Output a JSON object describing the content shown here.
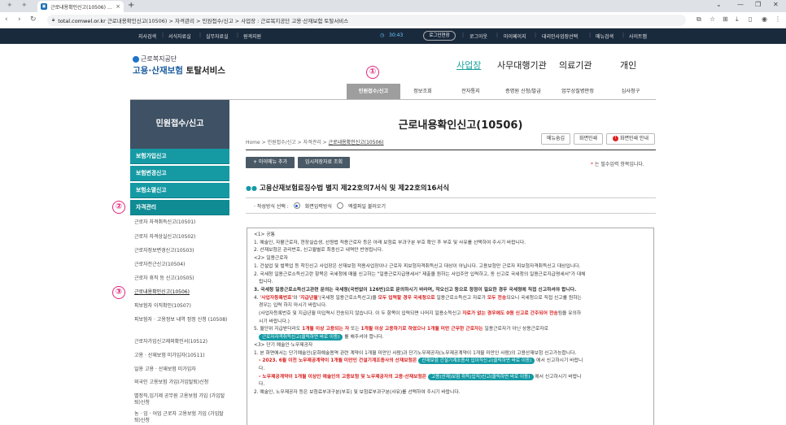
{
  "browser": {
    "tab_title": "근로내용확인신고(10506) : 자",
    "new_tab": "+",
    "url_host": "total.comwel.or.kr",
    "url_rest": " 근로내용확인신고(10506) > 자격관리 > 민원접수/신고 > 사업장 : 근로복지공단 고용·산재보험 토탈서비스"
  },
  "topbar": {
    "left_links": [
      "지사검색",
      "서식자료실",
      "실무자료실",
      "원격지원"
    ],
    "timer": "30:43",
    "extend": "로그인연장",
    "right_links": [
      "로그아웃",
      "마이페이지",
      "대리인사업장선택",
      "메뉴검색",
      "사이트맵"
    ]
  },
  "header": {
    "logo_sub": "근로복지공단",
    "logo_main_a": "고용·산재보험",
    "logo_main_b": " 토탈서비스",
    "nav": [
      "사업장",
      "사무대행기관",
      "의료기관",
      "개인"
    ]
  },
  "subtabs": [
    "민원접수/신고",
    "정보조회",
    "전자통지",
    "증명원 신청/발급",
    "업무상질병판정",
    "심사청구"
  ],
  "badges": [
    "①",
    "②",
    "③"
  ],
  "sidebar": {
    "title": "민원접수/신고",
    "groups": [
      "보험가입신고",
      "보험변경신고",
      "보험소멸신고",
      "자격관리"
    ],
    "items": [
      "근로자 자격취득신고(10501)",
      "근로자 자격상실신고(10502)",
      "근로자정보변경신고(10503)",
      "근로자전근신고(10504)",
      "근로자 휴직 등 신고(10505)",
      "근로내용확인신고(10506)",
      "피보험자 이직확인(10507)",
      "피보험자 · 고용정보 내역 정정 신청 (10508)",
      "근로자가입신고제외확인서(10512)",
      "고용 · 산재보험 미가입자(10511)",
      "일용 고용 · 산재보험 미가입자",
      "외국인 고용보험 가입(가입탈퇴)신청",
      "별정직,임기제 공무원 고용보험 가입 (가입탈퇴)신청",
      "농 · 임 · 어업 근로자 고용보험 가입 (가입탈퇴)신청"
    ]
  },
  "content": {
    "title": "근로내용확인신고(10506)",
    "breadcrumb": [
      "Home",
      "민원접수/신고",
      "자격관리",
      "근로내용확인신고(10506)"
    ],
    "crumb_sep": ">",
    "top_buttons": [
      "메뉴숨김",
      "화면인쇄",
      "화면인쇄 안내"
    ],
    "info_icon": "!",
    "action_buttons": [
      "+ 마이메뉴 추가",
      "임시저장자료 조회"
    ],
    "required_mark": "*",
    "required_note": "는 필수입력 항목입니다.",
    "section_dots": "●●",
    "section_title": "고용산재보험료징수법 별지 제22호의7서식 및 제22호의16서식",
    "method_label": "· 작성방식 선택 :",
    "method_options": [
      "화면입력방식",
      "엑셀파일 불러오기"
    ]
  },
  "notice": {
    "l1": "<1> 공통",
    "l2": "1. 예술인, 자활근로자, 현장실습생, 선원법 적용근로자 등은 아래 보험료 부과구분 부호 확인 후 부호 및 사유를 선택하여 주시기 바랍니다.",
    "l3": "2. 산재보험은 관리번호, 신고월별로 최종신고 내역만 반영됩니다.",
    "l4": "<2> 일용근로자",
    "l5": "1. 건설업 및 벌목업 등 착진신고 사업장은 산재보험 적용사업장이나 근로자 피보험자격취득신고 대상이 아닙니다. 고용보험만 근로자 피보험자격취득신고 대상입니다.",
    "l6": "2. 국세청 일용근로소득신고란 항목은 국세청에 매월 신고하는 \"일용근로지급명세서\" 제출을 원하는 사업주만 입력하고, 동 신고로 국세청의 일용근로지급명세서\"가 대체",
    "l7": "됩니다.",
    "l8a": "3. 국세청 일용근로소득신고관련 문의는 국세청(국번없이 126번)으로 문의하시기 바라며, 작오신고 등으로 정정이 필요한 경우 국세청에 직접 신고하셔야 합니다.",
    "l9a": "4. ",
    "l9b": "'사업자등록번호'",
    "l9c": "와 ",
    "l9d": "'지급년월'",
    "l9e": "(국세청 일용근로소득신고)을 ",
    "l9f": "모두 입력할 경우 국세청으로",
    "l9g": " 일용근로소득신고 자료가 ",
    "l9h": "모두 전송",
    "l9i": "되오니 국세청으로 직접 신고를 원하는",
    "l10": "경우는 입력 하지 마시기 바랍니다.",
    "l11a": "(사업자등록번호 및 지급년월 미입력시 전송되지 않습니다. 이 두 항목이 입력되면 나머지 일용소득신고 ",
    "l11b": "자료가 없는 경우에도 0원 신고로 간주되어 전송",
    "l11c": "됨을 유의하",
    "l12": "시기 바랍니다.)",
    "l13a": "5. 월단위 지급받더라도 ",
    "l13b": "1개월 이상 고용되는 자",
    "l13c": " 또는 ",
    "l13d": "1개월 이상 고용하기로 하였으나 1개월 미만 근무한 근로자는",
    "l13e": " 일용근로자가 아닌 상용근로자로",
    "l14b": "근로자자격취득신고(클릭하면 바로 이동)",
    "l14c": " 를 해주셔야 합니다.",
    "l15": "<3> 단기 예술인·노무제공자",
    "l16": "1. 본 화면에서는 단기예술인(문화예술용역 관련 계약이 1개월 미만인 사람)과 단기노무제공자(노무제공계약이 1개월 미만인 사람)의 고용산재보험 신고가능합니다.",
    "l17a": "- 2023. 6월 이전 노무제공계약이 1개월 미만인 건설기계조종사의 산재보험은 ",
    "l17b": "산재보험 건설기계조종사 입이직신고(클릭하면 바로 이동)",
    "l17c": " 에서 신고하시기 바랍니",
    "l18": "다.",
    "l19a": "- 노무제공계약이 1개월 이상인 예술인의 고용보험 및 노무제공자의 고용·산재보험은 ",
    "l19b": "고용(산재)보험 취득(입직)신고(클릭하면 바로 이동)",
    "l19c": " 에서 신고하시기 바랍니",
    "l20": "다.",
    "l21": "2. 예술인, 노무제공자 등은 보험료부과구분(부호) 및 보험료부과구분(사유)를 선택하여 주시기 바랍니다."
  }
}
